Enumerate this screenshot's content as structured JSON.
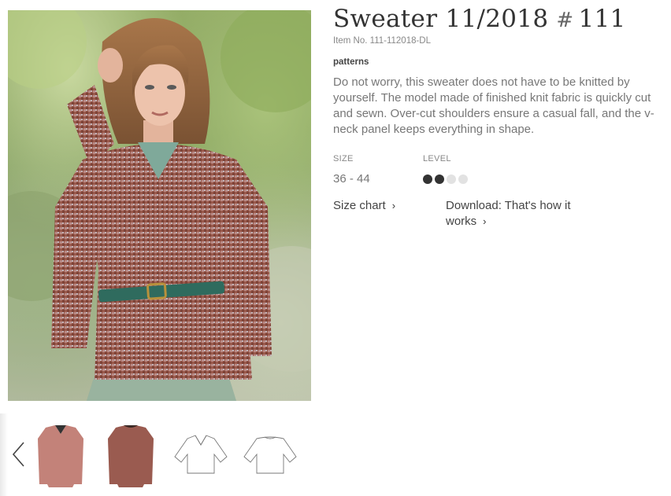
{
  "product": {
    "title": "Sweater 11/2018",
    "hash": "#",
    "number": "111",
    "item_no": "Item No. 111-112018-DL",
    "category": "patterns",
    "description": "Do not worry, this sweater does not have to be knitted by yourself. The model made of finished knit fabric is quickly cut and sewn. Over-cut shoulders ensure a casual fall, and the v-neck panel keeps everything in shape."
  },
  "specs": {
    "size_label": "SIZE",
    "size_value": "36 - 44",
    "level_label": "LEVEL",
    "level": 2,
    "level_max": 4
  },
  "links": {
    "size_chart": "Size chart",
    "download": "Download: That's how it works"
  },
  "gallery": {
    "prev_icon": "chevron-left-icon",
    "thumbnails": [
      "sweater-front-photo",
      "sweater-back-photo",
      "sweater-front-sketch",
      "sweater-back-sketch"
    ]
  },
  "colors": {
    "sweater": "#9b5a4c",
    "belt": "#2f6b5e",
    "text": "#777777"
  }
}
